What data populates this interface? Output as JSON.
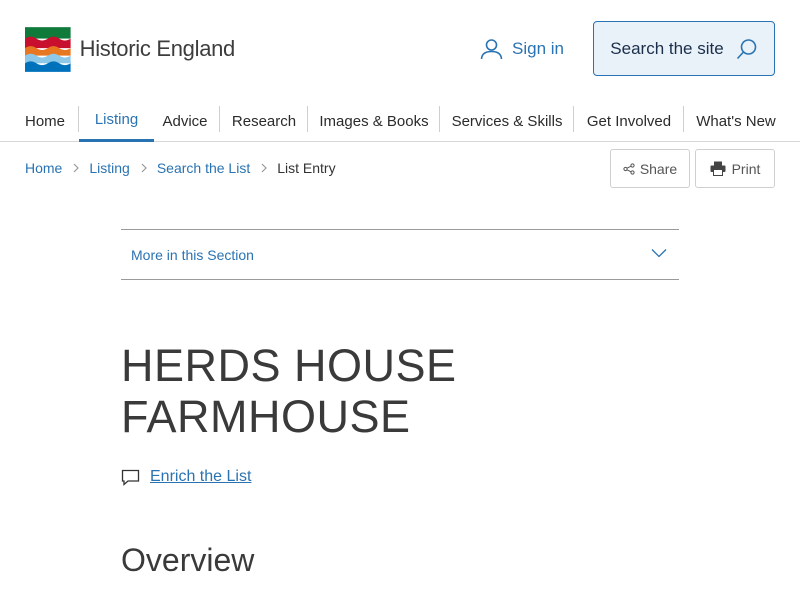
{
  "header": {
    "logo_text": "Historic England",
    "signin_label": "Sign in",
    "search_label": "Search the site"
  },
  "nav": {
    "items": [
      {
        "label": "Home"
      },
      {
        "label": "Listing"
      },
      {
        "label": "Advice"
      },
      {
        "label": "Research"
      },
      {
        "label": "Images & Books"
      },
      {
        "label": "Services & Skills"
      },
      {
        "label": "Get Involved"
      },
      {
        "label": "What's New"
      }
    ],
    "active": "Listing"
  },
  "breadcrumb": {
    "items": [
      "Home",
      "Listing",
      "Search the List",
      "List Entry"
    ]
  },
  "actions": {
    "share_label": "Share",
    "print_label": "Print"
  },
  "section": {
    "toggle_label": "More in this Section"
  },
  "entry": {
    "title": "HERDS HOUSE FARMHOUSE",
    "enrich_label": "Enrich the List",
    "overview_heading": "Overview"
  },
  "colors": {
    "link": "#2a73b2",
    "search_bg": "#e9f1f9",
    "text_dark": "#3a3a3a"
  },
  "icons": {
    "user": "user-icon",
    "search": "search-icon",
    "share": "share-icon",
    "print": "printer-icon",
    "chevron": "chevron-down-icon",
    "comment": "comment-icon"
  }
}
